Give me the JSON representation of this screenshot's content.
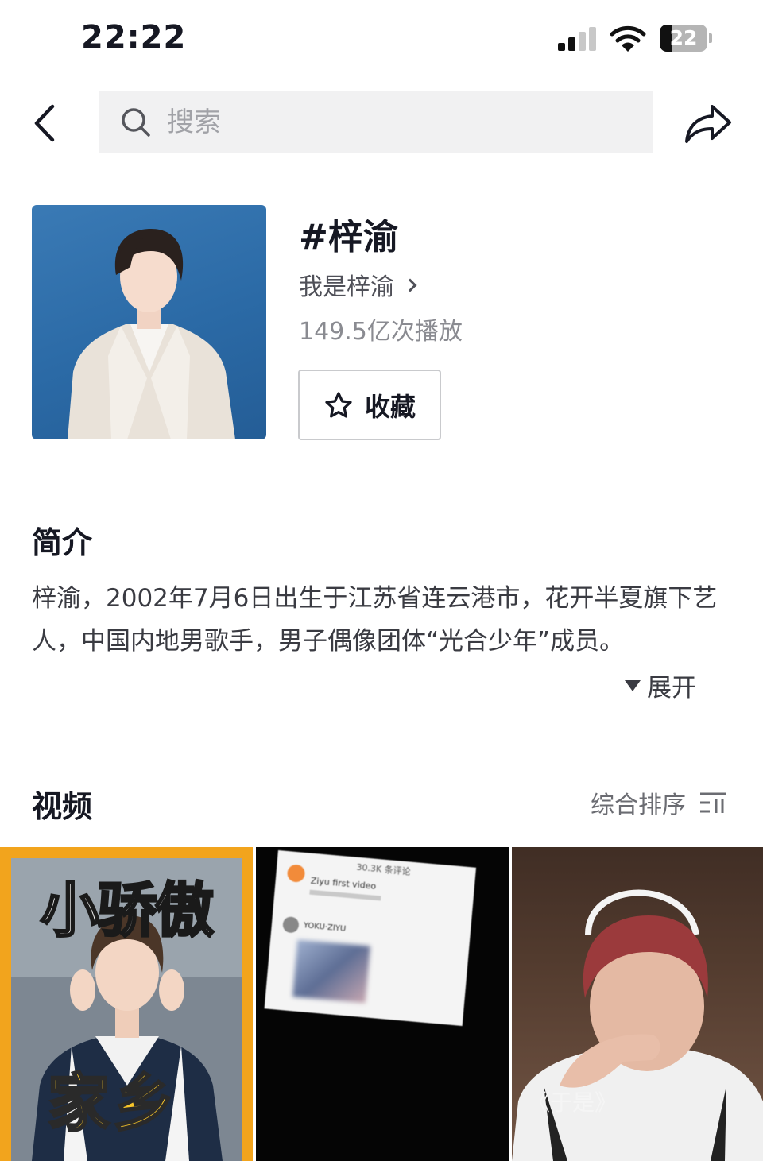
{
  "status_bar": {
    "time": "22:22",
    "battery": "22"
  },
  "nav": {
    "search_placeholder": "搜索"
  },
  "topic": {
    "title": "#梓渝",
    "creator": "我是梓渝",
    "plays": "149.5亿次播放",
    "favorite_label": "收藏"
  },
  "intro": {
    "heading": "简介",
    "text": "梓渝，2002年7月6日出生于江苏省连云港市，花开半夏旗下艺人，中国内地男歌手，男子偶像团体“光合少年”成员。",
    "expand_label": "展开"
  },
  "videos": {
    "heading": "视频",
    "sort_label": "综合排序",
    "tiles": [
      {
        "title_top": "小骄傲",
        "title_bottom": "家乡"
      },
      {
        "comments_header": "30.3K 条评论",
        "comment_1": "Ziyu first video",
        "comment_2": "YOKU·ZIYU"
      },
      {
        "caption": "《于是》"
      }
    ]
  },
  "colors": {
    "cover_bg": "#2b6aa6",
    "tile1_bg": "#f2a41d",
    "title_yellow": "#f7c52a"
  }
}
